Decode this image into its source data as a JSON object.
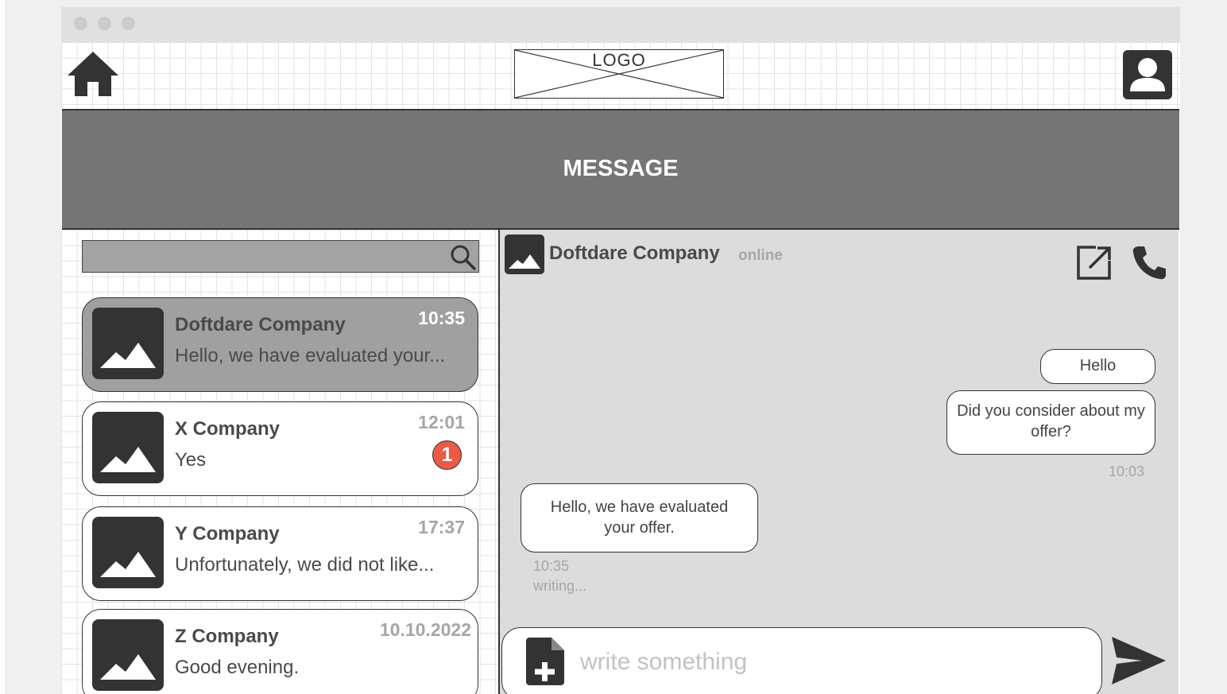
{
  "topbar": {
    "logo_text": "LOGO"
  },
  "header": {
    "title": "MESSAGE"
  },
  "search": {
    "value": "",
    "placeholder": ""
  },
  "conversations": [
    {
      "name": "Doftdare Company",
      "preview": "Hello, we have evaluated your...",
      "time": "10:35",
      "active": true
    },
    {
      "name": "X Company",
      "preview": "Yes",
      "time": "12:01",
      "unread": "1"
    },
    {
      "name": "Y Company",
      "preview": "Unfortunately, we did not like...",
      "time": "17:37"
    },
    {
      "name": "Z Company",
      "preview": "Good evening.",
      "time": "10.10.2022"
    }
  ],
  "chat": {
    "contact_name": "Doftdare Company",
    "status": "online",
    "messages": [
      {
        "text": "Hello",
        "side": "right"
      },
      {
        "text": "Did you consider about my offer?",
        "side": "right"
      },
      {
        "text": "Hello, we have evaluated your offer.",
        "side": "left"
      }
    ],
    "sent_time": "10:03",
    "received_time": "10:35",
    "typing_text": "writing..."
  },
  "composer": {
    "placeholder": "write something",
    "value": ""
  },
  "colors": {
    "header_bg": "#757575",
    "active_item": "#a0a0a0",
    "badge": "#ec5a45",
    "chat_bg": "#dcdcdc"
  },
  "icons": [
    "home-icon",
    "profile-icon",
    "search-icon",
    "image-placeholder-icon",
    "external-link-icon",
    "phone-icon",
    "attach-file-icon",
    "send-icon"
  ]
}
